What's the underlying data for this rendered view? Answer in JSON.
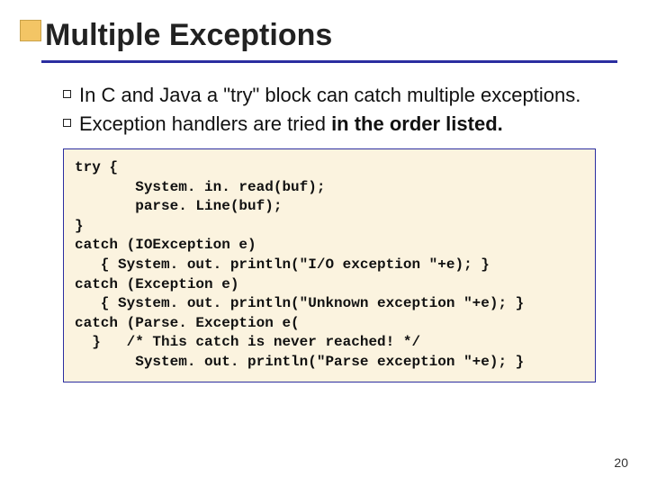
{
  "title": "Multiple Exceptions",
  "bullets": {
    "b1": "In C and Java a \"try\" block can catch multiple exceptions.",
    "b2_pre": "Exception handlers are tried ",
    "b2_bold": "in the order listed."
  },
  "code": "try {\n       System. in. read(buf);\n       parse. Line(buf);\n}\ncatch (IOException e)\n   { System. out. println(\"I/O exception \"+e); }\ncatch (Exception e)\n   { System. out. println(\"Unknown exception \"+e); }\ncatch (Parse. Exception e(\n  }   /* This catch is never reached! */\n       System. out. println(\"Parse exception \"+e); }",
  "page_number": "20"
}
